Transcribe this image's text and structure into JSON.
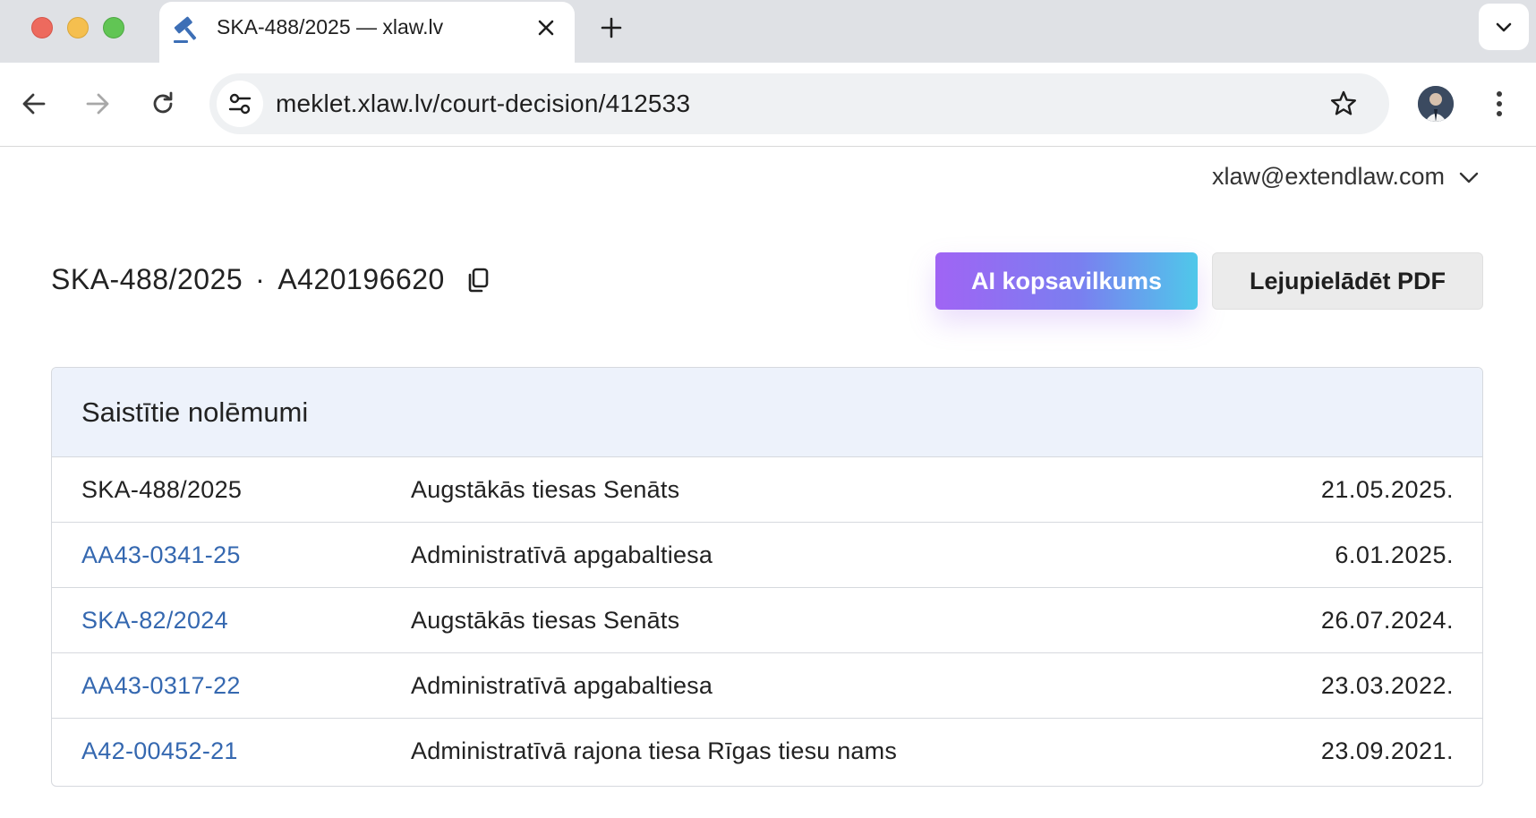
{
  "browser": {
    "tab": {
      "title": "SKA-488/2025 — xlaw.lv"
    },
    "url": "meklet.xlaw.lv/court-decision/412533"
  },
  "colors": {
    "link": "#3568b0",
    "ai_gradient_start": "#a064f4",
    "ai_gradient_end": "#4fc8ea",
    "table_header_bg": "#edf2fb"
  },
  "user": {
    "email": "xlaw@extendlaw.com"
  },
  "case": {
    "number": "SKA-488/2025",
    "separator": "·",
    "archive_number": "A420196620"
  },
  "actions": {
    "ai_summary_label": "AI kopsavilkums",
    "download_pdf_label": "Lejupielādēt PDF"
  },
  "related": {
    "title": "Saistītie nolēmumi",
    "rows": [
      {
        "id": "SKA-488/2025",
        "court": "Augstākās tiesas Senāts",
        "date": "21.05.2025.",
        "current": true
      },
      {
        "id": "AA43-0341-25",
        "court": "Administratīvā apgabaltiesa",
        "date": "6.01.2025.",
        "current": false
      },
      {
        "id": "SKA-82/2024",
        "court": "Augstākās tiesas Senāts",
        "date": "26.07.2024.",
        "current": false
      },
      {
        "id": "AA43-0317-22",
        "court": "Administratīvā apgabaltiesa",
        "date": "23.03.2022.",
        "current": false
      },
      {
        "id": "A42-00452-21",
        "court": "Administratīvā rajona tiesa Rīgas tiesu nams",
        "date": "23.09.2021.",
        "current": false
      }
    ]
  }
}
